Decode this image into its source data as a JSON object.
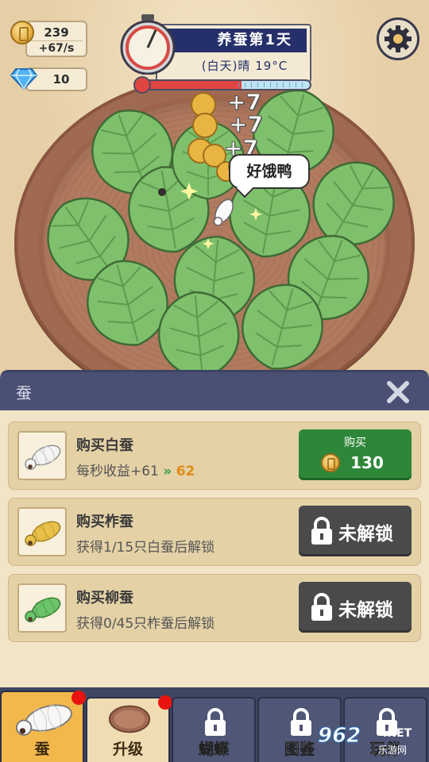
{
  "resources": {
    "coins": "239",
    "coins_per_sec": "+67/s",
    "diamonds": "10"
  },
  "day_panel": {
    "title": "养蚕第1天",
    "weather": "(白天)晴    19°C",
    "temperature_fraction": 0.6
  },
  "floaters": [
    "+7",
    "+7",
    "+7"
  ],
  "speech_bubble": "好饿鸭",
  "panel": {
    "title": "蚕",
    "rows": [
      {
        "name": "购买白蚕",
        "desc_prefix": "每秒收益+61",
        "desc_next": "62",
        "button_label": "购买",
        "price": "130",
        "locked": false,
        "worm_color": "#f4f4f2"
      },
      {
        "name": "购买柞蚕",
        "desc_prefix": "获得1/15只白蚕后解锁",
        "button_label": "未解锁",
        "locked": true,
        "worm_color": "#e8c14a"
      },
      {
        "name": "购买柳蚕",
        "desc_prefix": "获得0/45只柞蚕后解锁",
        "button_label": "未解锁",
        "locked": true,
        "worm_color": "#6cc46a"
      }
    ]
  },
  "nav": {
    "tabs": [
      {
        "label": "蚕"
      },
      {
        "label": "升级"
      },
      {
        "label": "蝴蝶"
      },
      {
        "label": "图鉴"
      },
      {
        "label": "玩伴"
      }
    ]
  },
  "watermark": {
    "main": "962",
    "net": ".NET",
    "sub": "乐游网"
  },
  "colors": {
    "accent": "#2e8738",
    "panel_header": "#4a5073",
    "tray": "#a06a52",
    "leaf": "#7cbf6a"
  }
}
